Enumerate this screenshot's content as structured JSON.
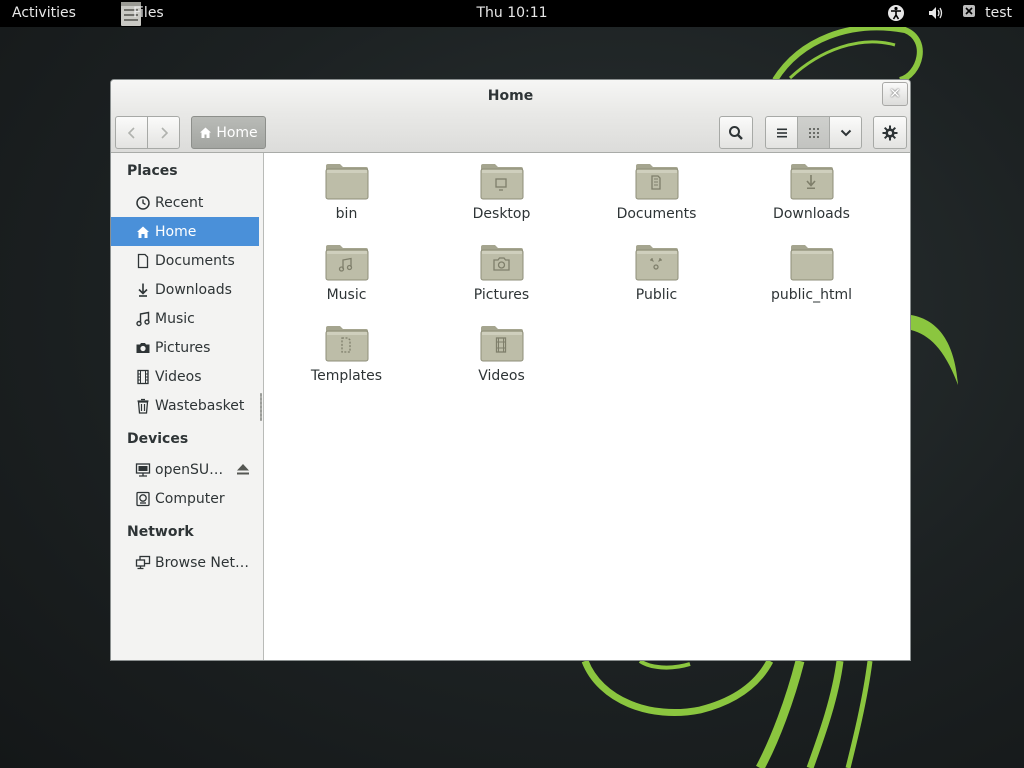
{
  "top_bar": {
    "activities_label": "Activities",
    "app_menu_label": "Files",
    "clock": "Thu 10:11",
    "user_name": "test",
    "tray_icons": [
      "accessibility-icon",
      "volume-icon",
      "user-status-icon"
    ]
  },
  "window": {
    "title": "Home",
    "close_symbol": "✕",
    "toolbar": {
      "path_button_label": "Home"
    },
    "sidebar": {
      "places_heading": "Places",
      "places": [
        {
          "label": "Recent",
          "icon": "clock-icon"
        },
        {
          "label": "Home",
          "icon": "home-icon",
          "selected": true
        },
        {
          "label": "Documents",
          "icon": "document-icon"
        },
        {
          "label": "Downloads",
          "icon": "download-icon"
        },
        {
          "label": "Music",
          "icon": "music-icon"
        },
        {
          "label": "Pictures",
          "icon": "camera-icon"
        },
        {
          "label": "Videos",
          "icon": "film-icon"
        },
        {
          "label": "Wastebasket",
          "icon": "trash-icon"
        }
      ],
      "devices_heading": "Devices",
      "devices": [
        {
          "label": "openSU…",
          "icon": "drive-icon",
          "ejectable": true
        },
        {
          "label": "Computer",
          "icon": "computer-icon"
        }
      ],
      "network_heading": "Network",
      "network": [
        {
          "label": "Browse Net…",
          "icon": "network-icon"
        }
      ]
    },
    "files": [
      {
        "name": "bin",
        "emblem": "none"
      },
      {
        "name": "Desktop",
        "emblem": "desktop"
      },
      {
        "name": "Documents",
        "emblem": "documents"
      },
      {
        "name": "Downloads",
        "emblem": "downloads"
      },
      {
        "name": "Music",
        "emblem": "music"
      },
      {
        "name": "Pictures",
        "emblem": "pictures"
      },
      {
        "name": "Public",
        "emblem": "public"
      },
      {
        "name": "public_html",
        "emblem": "none"
      },
      {
        "name": "Templates",
        "emblem": "templates"
      },
      {
        "name": "Videos",
        "emblem": "videos"
      }
    ]
  },
  "colors": {
    "selection": "#4a90d9",
    "wallpaper_accent": "#8bc63f",
    "folder": "#b9b9a4"
  }
}
